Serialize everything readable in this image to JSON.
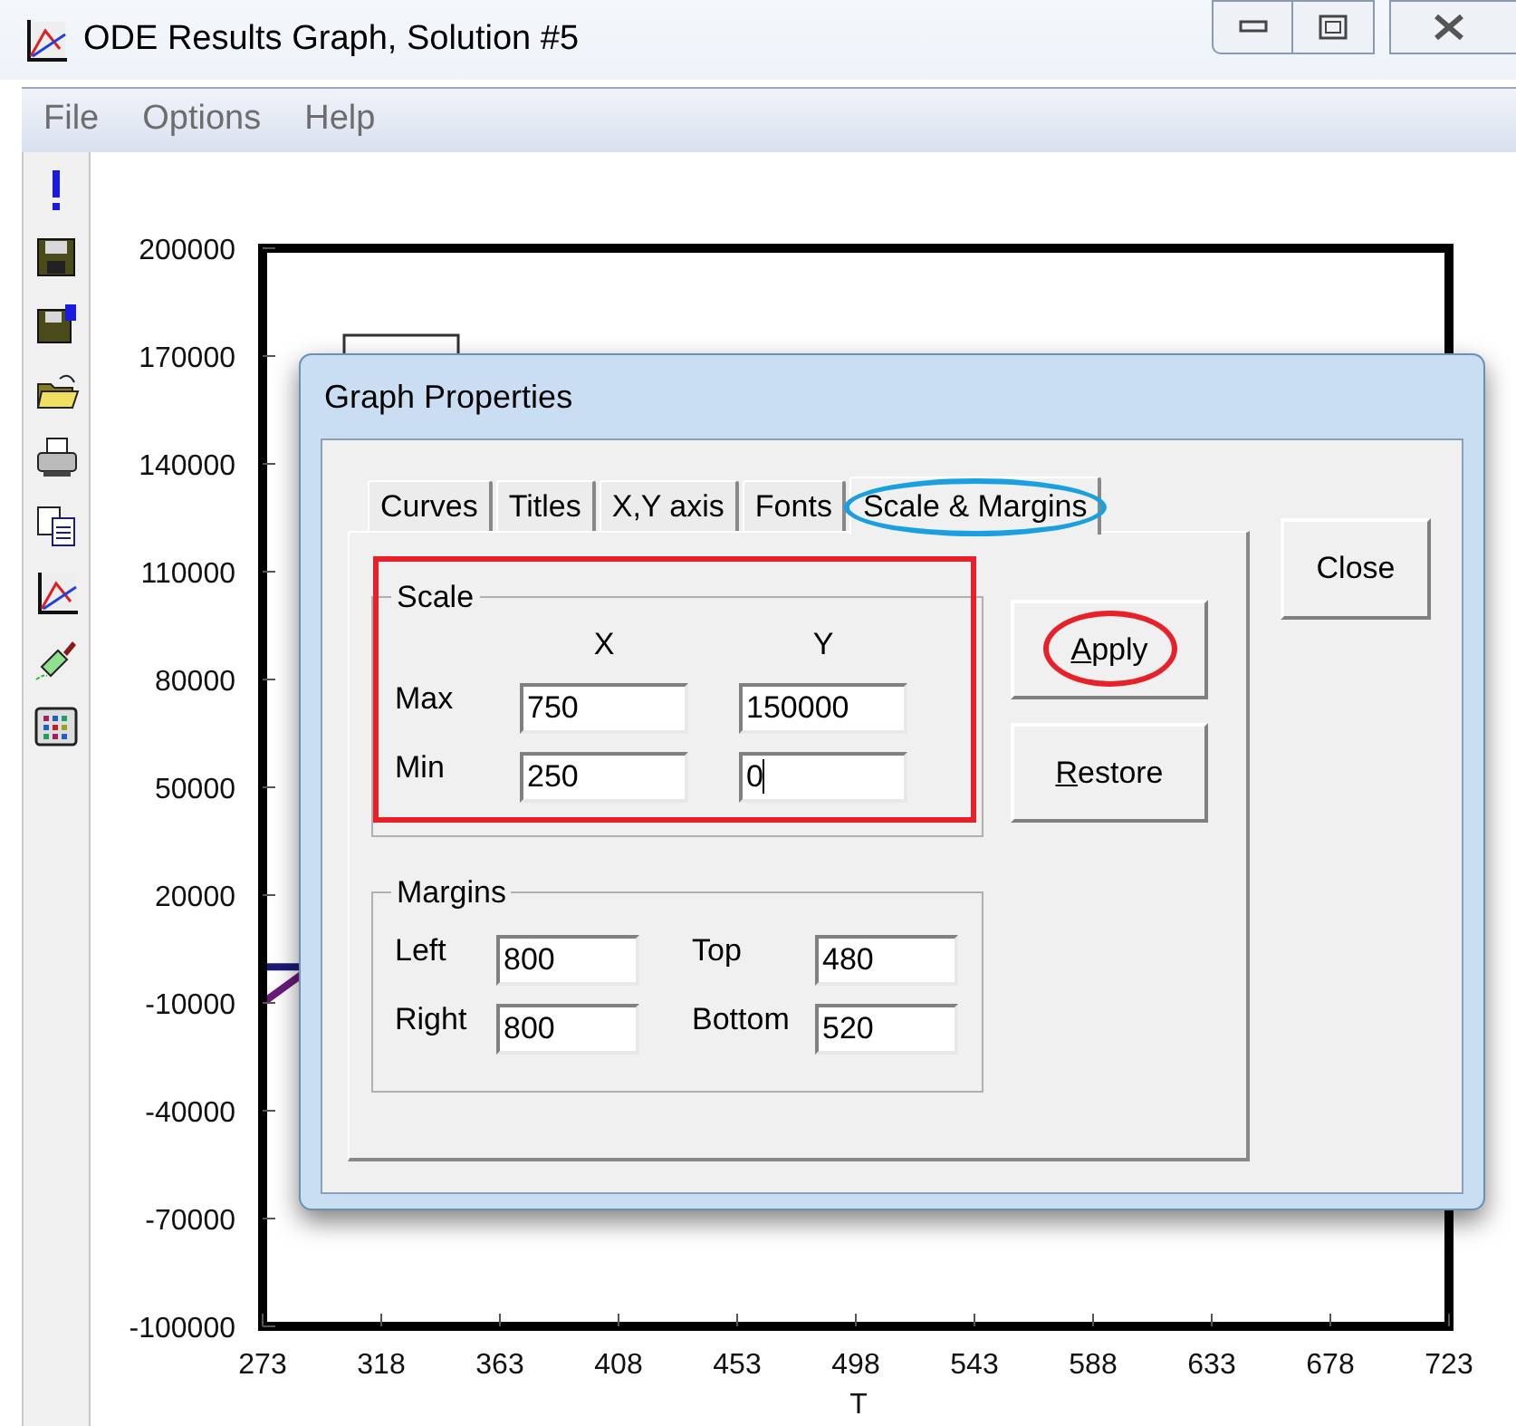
{
  "window": {
    "title": "ODE Results Graph, Solution #5"
  },
  "menu": [
    "File",
    "Options",
    "Help"
  ],
  "graph": {
    "chart_data": {
      "type": "line",
      "xlabel": "T",
      "xlim": [
        273,
        723
      ],
      "ylim": [
        -100000,
        200000
      ],
      "xticks": [
        273,
        318,
        363,
        408,
        453,
        498,
        543,
        588,
        633,
        678,
        723
      ],
      "yticks": [
        -100000,
        -70000,
        -40000,
        -10000,
        20000,
        50000,
        80000,
        110000,
        140000,
        170000,
        200000
      ],
      "x": [
        273,
        288
      ],
      "series": [
        {
          "color": "#1a1a7a",
          "values": [
            0,
            0
          ]
        },
        {
          "color": "#6a1a7a",
          "values": [
            -10000,
            -2000
          ]
        }
      ]
    }
  },
  "dialog": {
    "title": "Graph Properties",
    "tabs": [
      {
        "label": "Curves",
        "selected": false,
        "circled": false
      },
      {
        "label": "Titles",
        "selected": false,
        "circled": false
      },
      {
        "label": "X,Y axis",
        "selected": false,
        "circled": false
      },
      {
        "label": "Fonts",
        "selected": false,
        "circled": false
      },
      {
        "label": "Scale & Margins",
        "selected": true,
        "circled": true
      }
    ],
    "scale": {
      "title": "Scale",
      "boxed": true,
      "columns": [
        "X",
        "Y"
      ],
      "rows": [
        {
          "label": "Max",
          "fields": [
            {
              "value": "750",
              "focused": false
            },
            {
              "value": "150000",
              "focused": false
            }
          ]
        },
        {
          "label": "Min",
          "fields": [
            {
              "value": "250",
              "focused": false
            },
            {
              "value": "0",
              "focused": true
            }
          ]
        }
      ]
    },
    "margins": {
      "title": "Margins",
      "rows": [
        [
          {
            "label": "Left",
            "value": "800"
          },
          {
            "label": "Top",
            "value": "480"
          }
        ],
        [
          {
            "label": "Right",
            "value": "800"
          },
          {
            "label": "Bottom",
            "value": "520"
          }
        ]
      ]
    },
    "buttons": [
      {
        "label": "Apply",
        "underline_first": true,
        "circled": true
      },
      {
        "label": "Restore",
        "underline_first": true,
        "circled": false
      }
    ],
    "close": "Close"
  }
}
